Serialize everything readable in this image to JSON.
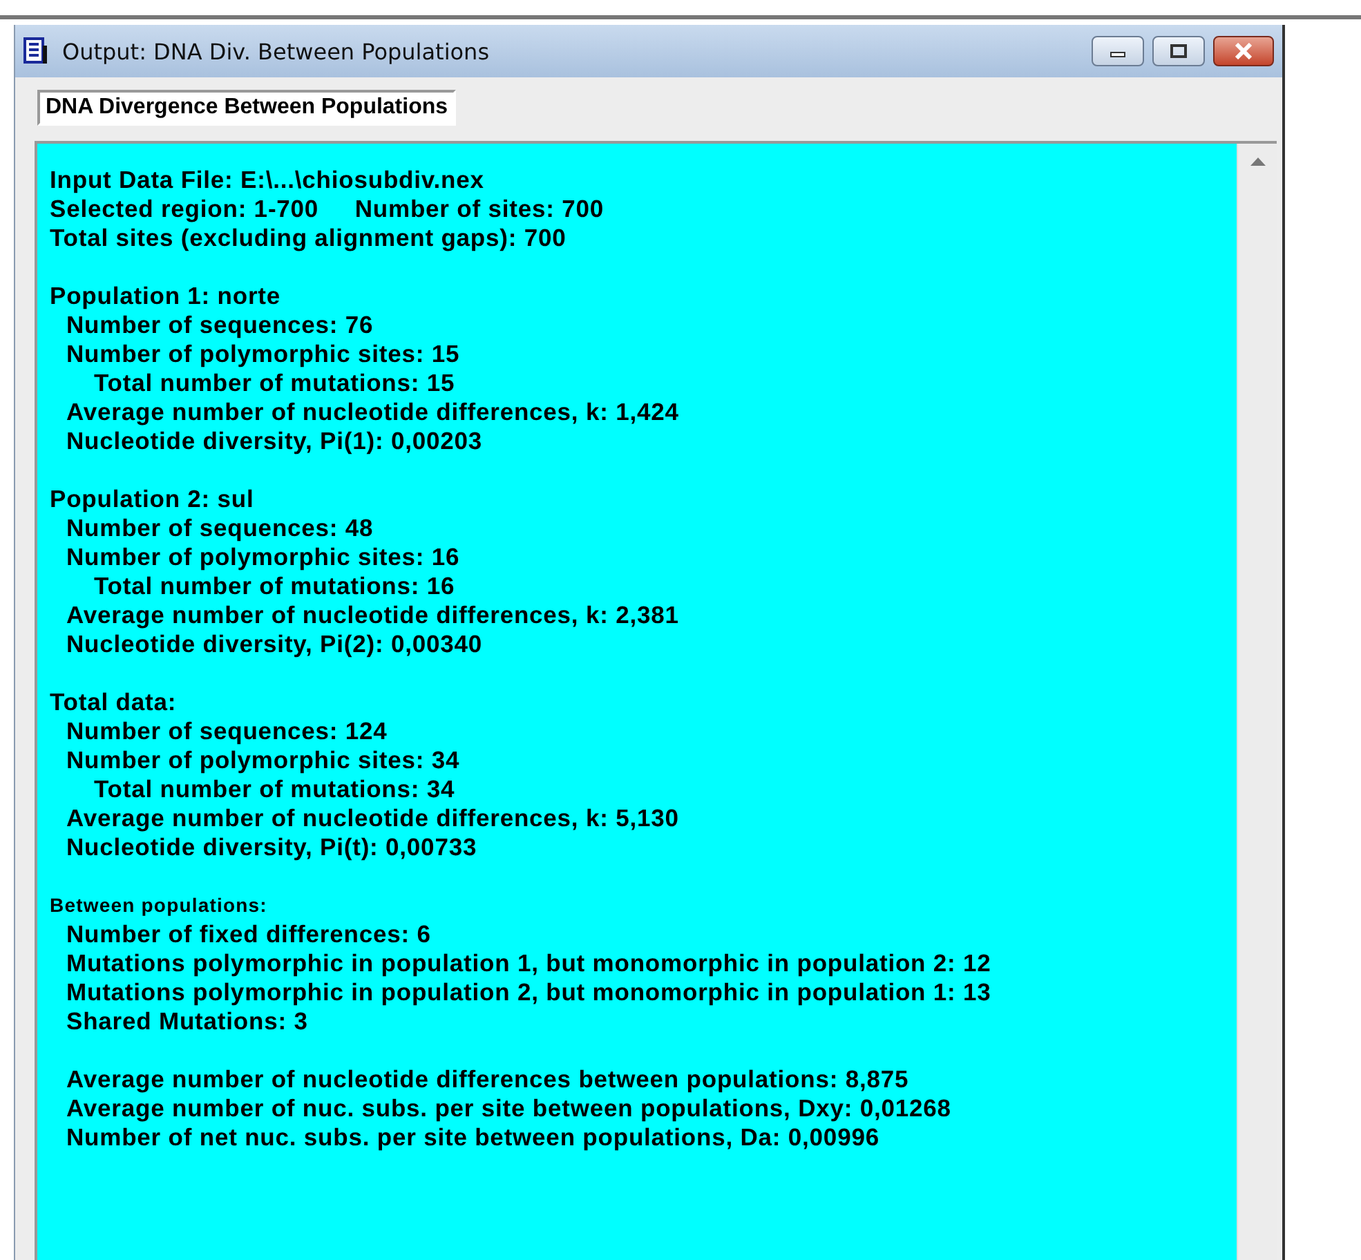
{
  "window": {
    "title": "Output: DNA Div. Between Populations"
  },
  "tab": {
    "label": "DNA Divergence Between Populations"
  },
  "report": [
    {
      "items": [
        {
          "kind": "line",
          "text": "Input Data File: E:\\...\\chiosubdiv.nex"
        },
        {
          "kind": "line",
          "text": "Selected region: 1-700     Number of sites: 700"
        },
        {
          "kind": "line",
          "text": "Total sites (excluding alignment gaps): 700"
        }
      ]
    },
    {
      "items": [
        {
          "kind": "line",
          "text": "Population 1: norte",
          "children": [
            {
              "kind": "line",
              "text": "Number of sequences: 76"
            },
            {
              "kind": "line",
              "text": "Number of polymorphic sites: 15",
              "children": [
                {
                  "kind": "line",
                  "text": "Total number of mutations: 15"
                }
              ]
            },
            {
              "kind": "line",
              "text": "Average number of nucleotide differences, k: 1,424"
            },
            {
              "kind": "line",
              "text": "Nucleotide diversity, Pi(1): 0,00203"
            }
          ]
        }
      ]
    },
    {
      "items": [
        {
          "kind": "line",
          "text": "Population 2: sul",
          "children": [
            {
              "kind": "line",
              "text": "Number of sequences: 48"
            },
            {
              "kind": "line",
              "text": "Number of polymorphic sites: 16",
              "children": [
                {
                  "kind": "line",
                  "text": "Total number of mutations: 16"
                }
              ]
            },
            {
              "kind": "line",
              "text": "Average number of nucleotide differences, k: 2,381"
            },
            {
              "kind": "line",
              "text": "Nucleotide diversity, Pi(2): 0,00340"
            }
          ]
        }
      ]
    },
    {
      "items": [
        {
          "kind": "line",
          "text": "Total data:",
          "children": [
            {
              "kind": "line",
              "text": "Number of sequences: 124"
            },
            {
              "kind": "line",
              "text": "Number of polymorphic sites: 34",
              "children": [
                {
                  "kind": "line",
                  "text": "Total number of mutations: 34"
                }
              ]
            },
            {
              "kind": "line",
              "text": "Average number of nucleotide differences, k: 5,130"
            },
            {
              "kind": "line",
              "text": "Nucleotide diversity, Pi(t): 0,00733"
            }
          ]
        }
      ]
    },
    {
      "items": [
        {
          "kind": "subheading",
          "text": "Between populations:",
          "children": [
            {
              "kind": "line",
              "text": "Number of fixed differences: 6"
            },
            {
              "kind": "line",
              "text": "Mutations polymorphic in population 1, but monomorphic in population 2: 12"
            },
            {
              "kind": "line",
              "text": "Mutations polymorphic in population 2, but monomorphic in population 1: 13"
            },
            {
              "kind": "line",
              "text": "Shared Mutations: 3"
            },
            {
              "kind": "gap"
            },
            {
              "kind": "line",
              "text": "Average number of nucleotide differences between populations: 8,875"
            },
            {
              "kind": "line",
              "text": "Average number of nuc. subs. per site between populations, Dxy: 0,01268"
            },
            {
              "kind": "line",
              "text": "Number of net nuc. subs. per site between populations, Da: 0,00996"
            }
          ]
        }
      ]
    }
  ]
}
